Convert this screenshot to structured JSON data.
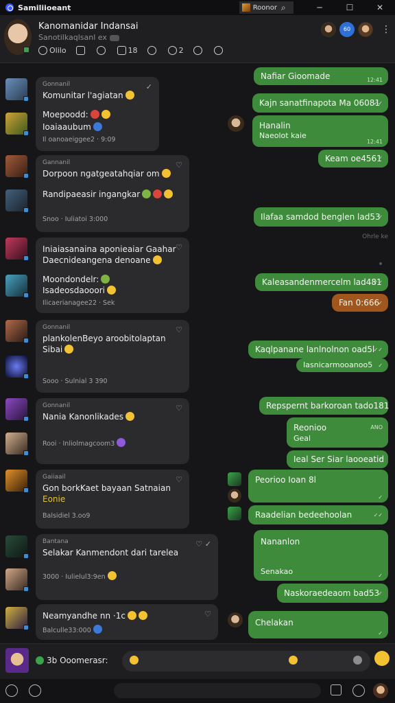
{
  "window": {
    "title": "Samiliioeant",
    "tab_label": "Roonor",
    "min": "─",
    "max": "☐",
    "close": "✕"
  },
  "header": {
    "title": "Kanomanidar Indansai",
    "subtitle": "Sanotilkaqlsanl ex",
    "tools": [
      {
        "icon": "people-icon",
        "label": "Olilo"
      },
      {
        "icon": "lock-icon",
        "label": ""
      },
      {
        "icon": "emoji-icon",
        "label": ""
      },
      {
        "icon": "video-icon",
        "label": "18"
      },
      {
        "icon": "search-icon",
        "label": ""
      },
      {
        "icon": "info-icon",
        "label": "2"
      },
      {
        "icon": "alert-icon",
        "label": ""
      },
      {
        "icon": "tools-icon",
        "label": ""
      }
    ],
    "badge": "60",
    "menu": "⋮"
  },
  "incoming": [
    {
      "name": "Gonnanil",
      "lines": [
        "Komunitar l'agiatan"
      ],
      "meta": "Il oanoaeiggee2  ·  9:09",
      "react": "✓",
      "avatar": [
        "#6a8fb8",
        "#2a3d56"
      ]
    },
    {
      "name": "",
      "lines": [
        "Moepoodd:",
        "Ioaiaaubum"
      ],
      "meta": "",
      "react": "",
      "avatar": [
        "#d0a23a",
        "#3d5a1a"
      ]
    },
    {
      "name": "Gannanil",
      "lines": [
        "Dorpoon ngatgeatahqiar  om"
      ],
      "meta": "",
      "react": "♡",
      "avatar": [
        "#a05a3a",
        "#3a1e14"
      ]
    },
    {
      "name": "",
      "lines": [
        "Randipaeasir ingangkar"
      ],
      "meta": "Snoo  ·  Iuliatoi 3:000",
      "react": "",
      "avatar": [
        "#446078",
        "#1a2430"
      ]
    },
    {
      "name": "",
      "lines": [
        "Iniaiasanaina aponieaiar Gaahar",
        "Daecnideangena  denoane"
      ],
      "meta": "",
      "react": "♡",
      "avatar": [
        "#c03a5a",
        "#3a1020"
      ]
    },
    {
      "name": "",
      "lines": [
        "Moondondelr:",
        "Isadeosdaooori"
      ],
      "meta": "Ilicaerianagee22  ·  Sek",
      "react": "",
      "avatar": [
        "#4aa0c0",
        "#14303a"
      ]
    },
    {
      "name": "Gonnanil",
      "lines": [
        "plankolenBeyo aroobitolaptan",
        "Sibai"
      ],
      "meta": "Sooo  ·  Sulnial 3 390",
      "react": "♡",
      "avatar": [
        "#b06a4a",
        "#2a1a14"
      ]
    },
    {
      "name": "",
      "lines": [],
      "meta": "",
      "react": "",
      "avatar": [
        "#3a4ad0",
        "#0a0e30"
      ]
    },
    {
      "name": "Gonnanil",
      "lines": [
        "Nania Kanonlikades"
      ],
      "meta": "Rooi  ·  Inliolmagcoom3",
      "react": "♡",
      "avatar": [
        "#8a4ac0",
        "#2a1440"
      ]
    },
    {
      "name": "",
      "lines": [],
      "meta": "",
      "react": "",
      "avatar": [
        "#d0b090",
        "#3a2a20"
      ]
    },
    {
      "name": "Gaiiaail",
      "lines": [
        "Gon borkKaet bayaan Satnaian",
        "Eonie"
      ],
      "meta": "Balsidiel 3.oo9",
      "react": "♡",
      "avatar": [
        "#e0902a",
        "#3a2008"
      ]
    },
    {
      "name": "Bantana",
      "lines": [
        "Selakar Kanmendont dari tarelea"
      ],
      "meta": "3000  ·  Iulielul3:9en",
      "react": "♡ ✓",
      "avatar": [
        "#2a4a3a",
        "#0e1a14"
      ]
    },
    {
      "name": "",
      "lines": [],
      "meta": "",
      "react": "",
      "avatar": [
        "#d0a888",
        "#3a2a22"
      ]
    },
    {
      "name": "",
      "lines": [
        "Neamyandhe nn  ·1c"
      ],
      "meta": "Balculle33:000",
      "react": "♡",
      "avatar": [
        "#d0b040",
        "#302040"
      ]
    }
  ],
  "outgoing": [
    {
      "text": "Nafiar Gioomade",
      "time": "12:41"
    },
    {
      "text": "Kajn sanatfinapota Ma 06081",
      "time": "✓✓"
    },
    {
      "text": "Hanalin",
      "sub": "Naeolot kaie",
      "time": "12:41"
    },
    {
      "text": "Keam oe4561",
      "time": "✓"
    },
    {
      "text": "Ilafaa samdod benglen lad53",
      "time": "✓"
    },
    {
      "text": "Kaleasandenmercelm lad481",
      "time": "✓✓"
    },
    {
      "text": "Fan 0:666",
      "time": "✓"
    },
    {
      "text": "Kaqlpanane lanlnolnon oad5l",
      "time": "✓✓"
    },
    {
      "text": "Iasnicarmooanoo5",
      "time": "✓"
    },
    {
      "text": "Repspernt barkoroan tado181",
      "time": "✓"
    },
    {
      "text": "Reonioo",
      "sub": "Geal",
      "time": "ANO"
    },
    {
      "text": "Ieal Ser Siar laooeatid",
      "time": "✓"
    },
    {
      "text": "Peorioo Ioan 8l",
      "time": "✓"
    },
    {
      "text": "Raadelian bedeehoolan",
      "time": "✓✓"
    },
    {
      "text": "Nananlon",
      "sub": "Senakao",
      "time": "✓"
    },
    {
      "text": "Naskoraedeaom bad53",
      "time": "✓"
    },
    {
      "text": "Chelakan",
      "time": "✓"
    }
  ],
  "system": [
    "Ohrle ke"
  ],
  "composer": {
    "label": "3b  Ooomerasr:",
    "placeholder": ""
  },
  "bottom": {
    "icons": [
      "attach-icon",
      "at-icon",
      "sticker-icon",
      "reaction-icon"
    ]
  }
}
